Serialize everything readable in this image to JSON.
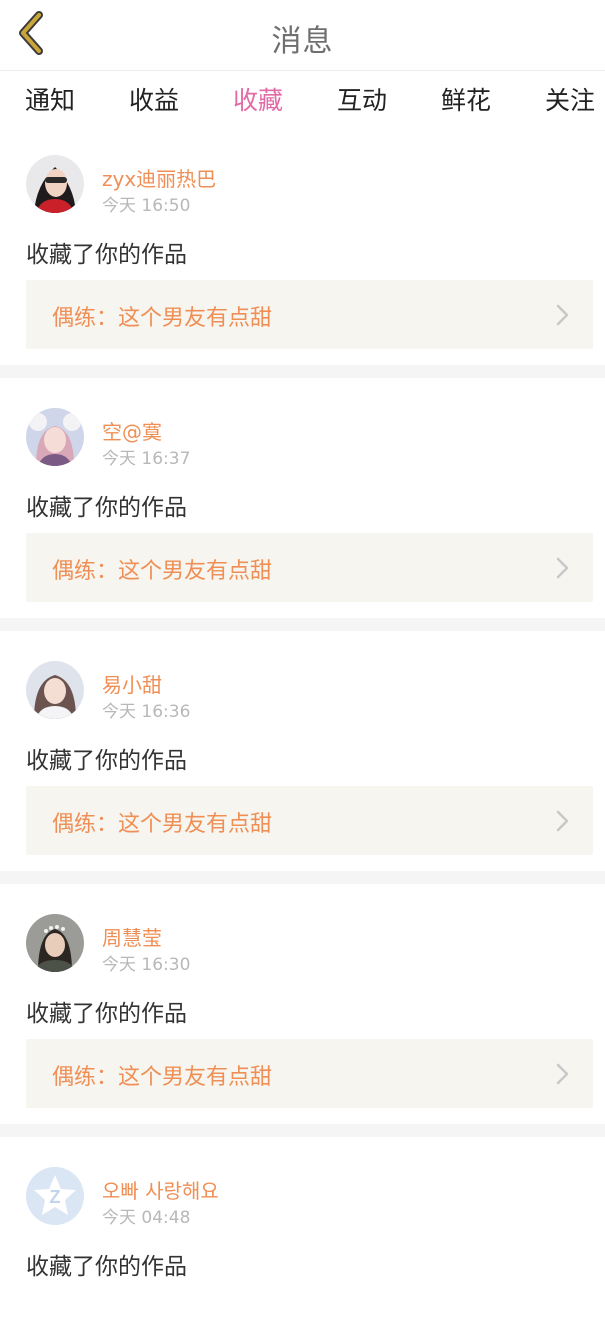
{
  "header": {
    "title": "消息",
    "back_icon": "chevron-left-icon",
    "back_icon_color": "#c9a53a"
  },
  "tabs": [
    {
      "label": "通知",
      "active": false
    },
    {
      "label": "收益",
      "active": false
    },
    {
      "label": "收藏",
      "active": true
    },
    {
      "label": "互动",
      "active": false
    },
    {
      "label": "鲜花",
      "active": false
    },
    {
      "label": "关注",
      "active": false
    }
  ],
  "colors": {
    "accent_pink": "#e46aa6",
    "accent_orange": "#f08f55",
    "link_background": "#f6f5ef",
    "separator": "#f5f5f5"
  },
  "notifications": [
    {
      "username": "zyx迪丽热巴",
      "time": "今天 16:50",
      "action": "收藏了你的作品",
      "work_title": "偶练：这个男友有点甜"
    },
    {
      "username": "空@寞",
      "time": "今天 16:37",
      "action": "收藏了你的作品",
      "work_title": "偶练：这个男友有点甜"
    },
    {
      "username": "易小甜",
      "time": "今天 16:36",
      "action": "收藏了你的作品",
      "work_title": "偶练：这个男友有点甜"
    },
    {
      "username": "周慧莹",
      "time": "今天 16:30",
      "action": "收藏了你的作品",
      "work_title": "偶练：这个男友有点甜"
    },
    {
      "username": "오빠 사랑해요",
      "time": "今天 04:48",
      "action": "收藏了你的作品"
    }
  ]
}
